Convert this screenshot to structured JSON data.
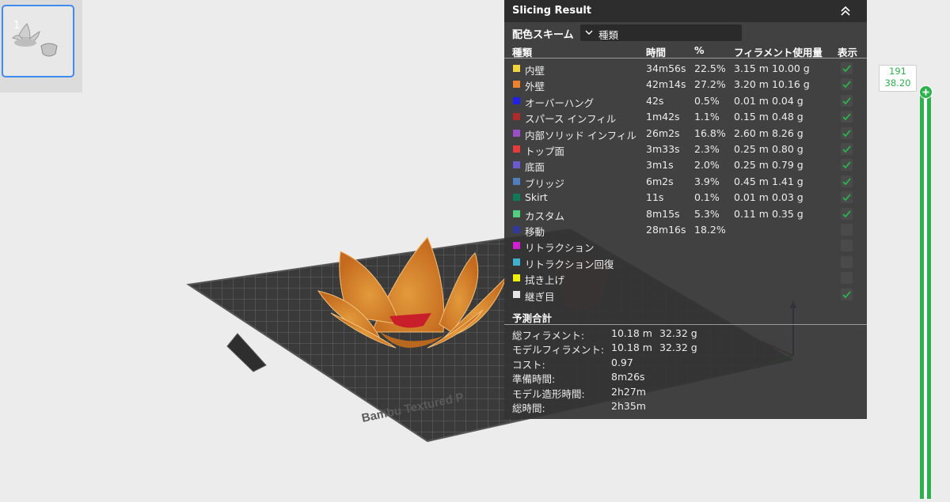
{
  "thumbnail": {
    "index": "1"
  },
  "panel": {
    "title": "Slicing Result",
    "scheme_label": "配色スキーム",
    "scheme_value": "種類",
    "headers": {
      "type": "種類",
      "time": "時間",
      "percent": "%",
      "filament": "フィラメント使用量",
      "show": "表示"
    },
    "rows": [
      {
        "name": "内壁",
        "color": "#f2d43d",
        "time": "34m56s",
        "pct": "22.5%",
        "len": "3.15 m",
        "wt": "10.00 g",
        "checked": true
      },
      {
        "name": "外壁",
        "color": "#f0822e",
        "time": "42m14s",
        "pct": "27.2%",
        "len": "3.20 m",
        "wt": "10.16 g",
        "checked": true
      },
      {
        "name": "オーバーハング",
        "color": "#2020e6",
        "time": "42s",
        "pct": "0.5%",
        "len": "0.01 m",
        "wt": "0.04 g",
        "checked": true
      },
      {
        "name": "スパース インフィル",
        "color": "#b02a2a",
        "time": "1m42s",
        "pct": "1.1%",
        "len": "0.15 m",
        "wt": "0.48 g",
        "checked": true
      },
      {
        "name": "内部ソリッド インフィル",
        "color": "#9a4fc9",
        "time": "26m2s",
        "pct": "16.8%",
        "len": "2.60 m",
        "wt": "8.26 g",
        "checked": true
      },
      {
        "name": "トップ面",
        "color": "#e63b3b",
        "time": "3m33s",
        "pct": "2.3%",
        "len": "0.25 m",
        "wt": "0.80 g",
        "checked": true
      },
      {
        "name": "底面",
        "color": "#6a5cd0",
        "time": "3m1s",
        "pct": "2.0%",
        "len": "0.25 m",
        "wt": "0.79 g",
        "checked": true
      },
      {
        "name": "ブリッジ",
        "color": "#4f7fbf",
        "time": "6m2s",
        "pct": "3.9%",
        "len": "0.45 m",
        "wt": "1.41 g",
        "checked": true
      },
      {
        "name": "Skirt",
        "color": "#0f7a5a",
        "time": "11s",
        "pct": "0.1%",
        "len": "0.01 m",
        "wt": "0.03 g",
        "checked": true
      },
      {
        "name": "カスタム",
        "color": "#4fcf7f",
        "time": "8m15s",
        "pct": "5.3%",
        "len": "0.11 m",
        "wt": "0.35 g",
        "checked": true
      },
      {
        "name": "移動",
        "color": "#2f3a9a",
        "time": "28m16s",
        "pct": "18.2%",
        "len": "",
        "wt": "",
        "checked": false
      },
      {
        "name": "リトラクション",
        "color": "#d21fd2",
        "time": "",
        "pct": "",
        "len": "",
        "wt": "",
        "checked": false
      },
      {
        "name": "リトラクション回復",
        "color": "#3fb0d0",
        "time": "",
        "pct": "",
        "len": "",
        "wt": "",
        "checked": false
      },
      {
        "name": "拭き上げ",
        "color": "#f2f200",
        "time": "",
        "pct": "",
        "len": "",
        "wt": "",
        "checked": false
      },
      {
        "name": "継ぎ目",
        "color": "#e6e6e6",
        "time": "",
        "pct": "",
        "len": "",
        "wt": "",
        "checked": true
      }
    ],
    "summary_title": "予測合計",
    "summary": [
      {
        "label": "総フィラメント:",
        "v1": "10.18 m",
        "v2": "32.32 g"
      },
      {
        "label": "モデルフィラメント:",
        "v1": "10.18 m",
        "v2": "32.32 g"
      },
      {
        "label": "コスト:",
        "v1": "0.97",
        "v2": ""
      },
      {
        "label": "準備時間:",
        "v1": "8m26s",
        "v2": ""
      },
      {
        "label": "モデル造形時間:",
        "v1": "2h27m",
        "v2": ""
      },
      {
        "label": "総時間:",
        "v1": "2h35m",
        "v2": ""
      }
    ]
  },
  "plate": {
    "text": "Bambu Textured P"
  },
  "layer_slider": {
    "layer": "191",
    "height": "38.20",
    "color": "#2bb24c"
  }
}
